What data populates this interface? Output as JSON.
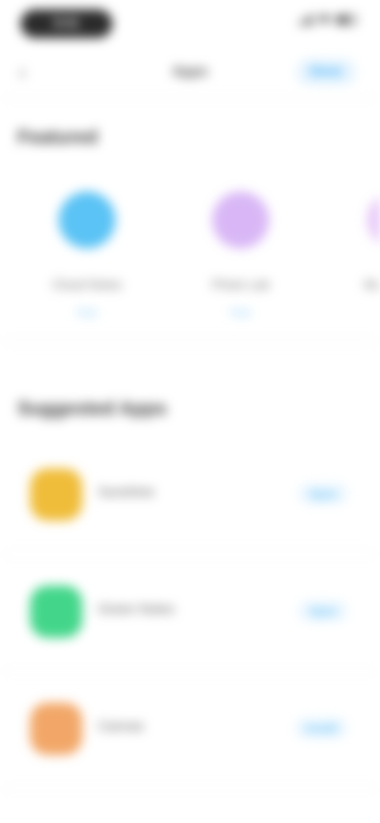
{
  "status_bar": {
    "time": "9:41"
  },
  "nav": {
    "back_glyph": "‹",
    "title": "Apps",
    "action": "Done"
  },
  "featured": {
    "heading": "Featured",
    "cards": [
      {
        "title": "Cloud Notes",
        "meta": "Free",
        "color": "#5bc3f5"
      },
      {
        "title": "Photo Lab",
        "meta": "Free",
        "color": "#d9b7f6"
      },
      {
        "title": "Mu",
        "meta": "",
        "color": "#e6c6f7"
      }
    ]
  },
  "suggested": {
    "heading": "Suggested Apps",
    "items": [
      {
        "name": "Sunshine",
        "action": "Open",
        "color": "#f0bd3a"
      },
      {
        "name": "Green Notes",
        "action": "Open",
        "color": "#43d68a"
      },
      {
        "name": "Canvas",
        "action": "Install",
        "color": "#f2a768"
      }
    ]
  },
  "colors": {
    "accent": "#29a3f2",
    "background": "#ffffff"
  }
}
